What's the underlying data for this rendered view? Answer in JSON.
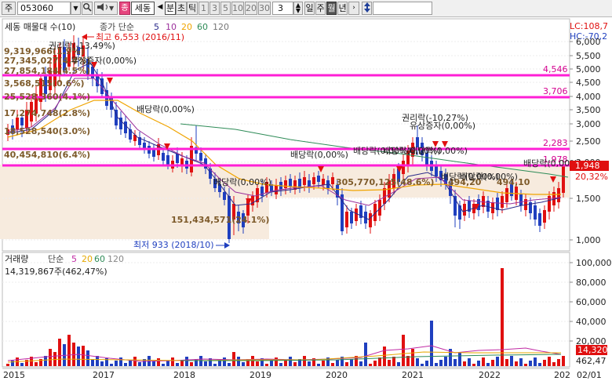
{
  "toolbar": {
    "market": "주",
    "code": "053060",
    "name": "세동",
    "tick": "분",
    "tick2": "초",
    "tick3": "틱",
    "intervals": [
      "1",
      "3",
      "5",
      "10",
      "20",
      "30"
    ],
    "interval_value": "3",
    "periods": [
      "일",
      "주",
      "월",
      "년"
    ],
    "selected_period": "월",
    "colors": {
      "accent": "#e6457e"
    }
  },
  "price_panel": {
    "title_label": "세동 매물대 수(10)",
    "ma_label": "종가 단순",
    "ma_periods": [
      "5",
      "10",
      "20",
      "60",
      "120"
    ],
    "ma_colors": [
      "#2a2a8a",
      "#9b2f9b",
      "#f0a400",
      "#2e8b57",
      "#777777"
    ],
    "lc_label": "LC:108,7",
    "hc_label": "HC:-70,2",
    "y_ticks": [
      "6,000",
      "5,500",
      "5,000",
      "4,500",
      "4,000",
      "3,500",
      "3,000",
      "2,500",
      "2,000",
      "1,500",
      "1,000"
    ],
    "max_label": "최고 6,553 (2016/11)",
    "min_label": "최저 933 (2018/10)",
    "current_price": "1,948",
    "current_pct": "20,32%",
    "hlines": [
      {
        "label": "4,546"
      },
      {
        "label": "3,706"
      },
      {
        "label": "2,283"
      },
      {
        "label": "1,978"
      }
    ],
    "volume_profile": [
      "9,319,966(1.9%)",
      "27,345,027(4.4%)",
      "27,854,184(4.5%)",
      "3,568,515(0.6%)",
      "25,528,360(4.1%)",
      "17,274,748(2.8%)",
      "18,528,540(3.0%)",
      "40,454,810(6.4%)",
      "151,434,571(24.1%)",
      "305,770,125(48.6%)",
      "494,20",
      "494,10"
    ],
    "events": [
      "권리락(-13,49%)",
      "무상증자(0,00%)",
      "배당락(0,00%)",
      "배당락(0,00%)",
      "배당락(0,00%)",
      "배당락(0,00%)",
      "배당락(0,00%)",
      "권리락(-10,27%)",
      "유상증자(0,00%)",
      "배당락(0,00%)",
      "배당락(0,00%)",
      "배당락(0,00%)",
      "배당락(0,00%)"
    ]
  },
  "volume_panel": {
    "title_label": "거래량",
    "ma_label": "단순",
    "ma_periods": [
      "5",
      "20",
      "60",
      "120"
    ],
    "ma_colors": [
      "#c02aa4",
      "#e6a800",
      "#2e8b57",
      "#888888"
    ],
    "current_volume": "14,319,867주(462,47%)",
    "y_ticks": [
      "100,000",
      "80,000",
      "60,000",
      "40,000",
      "20,000"
    ],
    "last_value": "14,320",
    "last_pct": "462,47"
  },
  "time_axis": {
    "labels": [
      "2015",
      "2017",
      "2018",
      "2019",
      "2020",
      "2021",
      "2022",
      "202"
    ],
    "end_label": "02/01"
  }
}
